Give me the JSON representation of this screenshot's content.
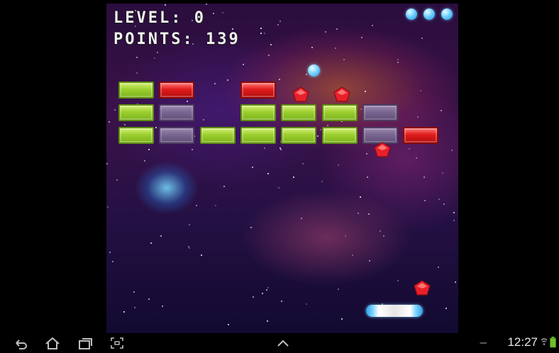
{
  "hud": {
    "level_text": "LEVEL: 0",
    "points_text": "POINTS: 139"
  },
  "lives": 3,
  "bricks": [
    {
      "row": 0,
      "col": 0,
      "color": "green"
    },
    {
      "row": 0,
      "col": 1,
      "color": "red"
    },
    {
      "row": 0,
      "col": 3,
      "color": "red"
    },
    {
      "row": 1,
      "col": 0,
      "color": "green"
    },
    {
      "row": 1,
      "col": 1,
      "color": "purple"
    },
    {
      "row": 1,
      "col": 3,
      "color": "green"
    },
    {
      "row": 1,
      "col": 4,
      "color": "green"
    },
    {
      "row": 1,
      "col": 5,
      "color": "green"
    },
    {
      "row": 1,
      "col": 6,
      "color": "purple"
    },
    {
      "row": 2,
      "col": 0,
      "color": "green"
    },
    {
      "row": 2,
      "col": 1,
      "color": "purple"
    },
    {
      "row": 2,
      "col": 2,
      "color": "green"
    },
    {
      "row": 2,
      "col": 3,
      "color": "green"
    },
    {
      "row": 2,
      "col": 4,
      "color": "green"
    },
    {
      "row": 2,
      "col": 5,
      "color": "green"
    },
    {
      "row": 2,
      "col": 6,
      "color": "purple"
    },
    {
      "row": 2,
      "col": 7,
      "color": "red"
    }
  ],
  "colors": {
    "green": "#9ccf2f",
    "red": "#e01c1c",
    "purple": "#7a6690",
    "ball": "#7fd6ff"
  },
  "status_bar": {
    "clock": "12:27",
    "nav_icons": [
      "back-icon",
      "home-icon",
      "recent-apps-icon",
      "screenshot-icon",
      "chevron-up-icon"
    ]
  }
}
